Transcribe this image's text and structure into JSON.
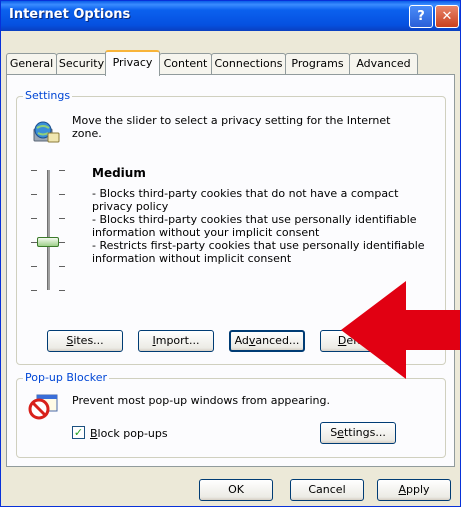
{
  "window": {
    "title": "Internet Options",
    "help_glyph": "?",
    "close_glyph": "✕"
  },
  "tabs": [
    {
      "label": "General"
    },
    {
      "label": "Security"
    },
    {
      "label": "Privacy",
      "active": true
    },
    {
      "label": "Content"
    },
    {
      "label": "Connections"
    },
    {
      "label": "Programs"
    },
    {
      "label": "Advanced"
    }
  ],
  "settings": {
    "group_label": "Settings",
    "instruction_line1": "Move the slider to select a privacy setting for the Internet",
    "instruction_line2": "zone.",
    "level_title": "Medium",
    "description_lines": [
      "- Blocks third-party cookies that do not have a compact",
      "privacy policy",
      "- Blocks third-party cookies that use personally identifiable",
      "information without your implicit consent",
      "- Restricts first-party cookies that use personally identifiable",
      "information without implicit consent"
    ],
    "sites_button": {
      "pre": "",
      "key": "S",
      "post": "ites..."
    },
    "import_button": {
      "pre": "",
      "key": "I",
      "post": "mport..."
    },
    "advanced_button": {
      "pre": "Ad",
      "key": "v",
      "post": "anced..."
    },
    "default_button": {
      "pre": "",
      "key": "D",
      "post": "efault"
    }
  },
  "popup": {
    "group_label": "Pop-up Blocker",
    "description": "Prevent most pop-up windows from appearing.",
    "block_checkbox": {
      "checked": true,
      "check_glyph": "✓",
      "pre": "",
      "key": "B",
      "post": "lock pop-ups"
    },
    "settings_button": {
      "pre": "S",
      "key": "e",
      "post": "ttings..."
    }
  },
  "footer": {
    "ok_label": "OK",
    "cancel_label": "Cancel",
    "apply_button": {
      "pre": "",
      "key": "A",
      "post": "pply"
    }
  },
  "colors": {
    "titlebar": "#0a5ee8",
    "active_tab_accent": "#f8b43a",
    "group_label": "#0046d5",
    "arrow": "#e10012"
  }
}
